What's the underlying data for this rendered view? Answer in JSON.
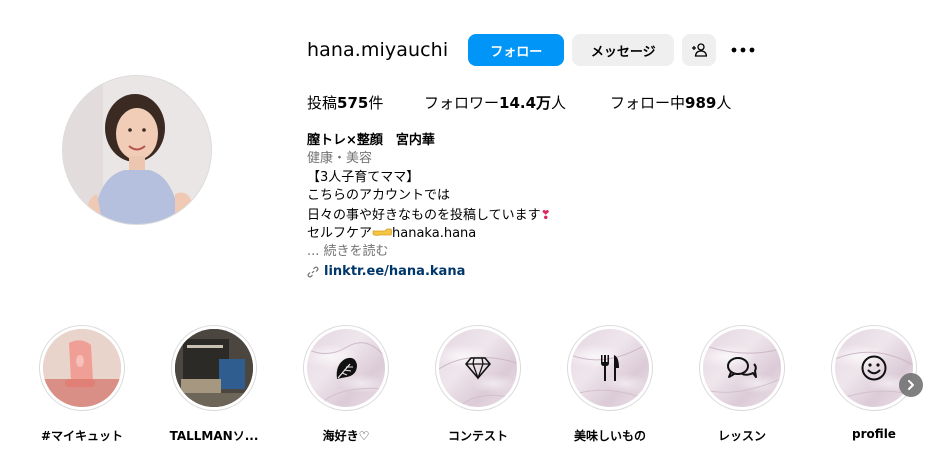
{
  "profile": {
    "username": "hana.miyauchi",
    "follow_label": "フォロー",
    "message_label": "メッセージ",
    "add_friend_icon": "person-add-icon",
    "more_icon": "more-horizontal-icon"
  },
  "stats": {
    "posts_prefix": "投稿",
    "posts_count": "575",
    "posts_suffix": "件",
    "followers_prefix": "フォロワー",
    "followers_count": "14.4万",
    "followers_suffix": "人",
    "following_prefix": "フォロー中",
    "following_count": "989",
    "following_suffix": "人"
  },
  "bio": {
    "name": "膣トレ×整顔　宮内華",
    "category": "健康・美容",
    "line1": "【3人子育てママ】",
    "line2": "こちらのアカウントでは",
    "line3": "日々の事や好きなものを投稿しています",
    "line3_emoji": "❣",
    "line4_prefix": "セルフケア",
    "line4_suffix": "hanaka.hana",
    "more_label": "... 続きを読む",
    "link": "linktr.ee/hana.kana"
  },
  "highlights": [
    {
      "label": "#マイキュット",
      "icon": "product-photo"
    },
    {
      "label": "TALLMANソ...",
      "icon": "product-photo"
    },
    {
      "label": "海好き♡",
      "icon": "monstera-leaf-icon"
    },
    {
      "label": "コンテスト",
      "icon": "diamond-icon"
    },
    {
      "label": "美味しいもの",
      "icon": "fork-knife-icon"
    },
    {
      "label": "レッスン",
      "icon": "chat-bubbles-icon"
    },
    {
      "label": "profile",
      "icon": "smiley-icon"
    }
  ],
  "colors": {
    "primary_blue": "#0095f6",
    "link_blue": "#00376b",
    "secondary_text": "#737373",
    "button_gray": "#efefef"
  }
}
